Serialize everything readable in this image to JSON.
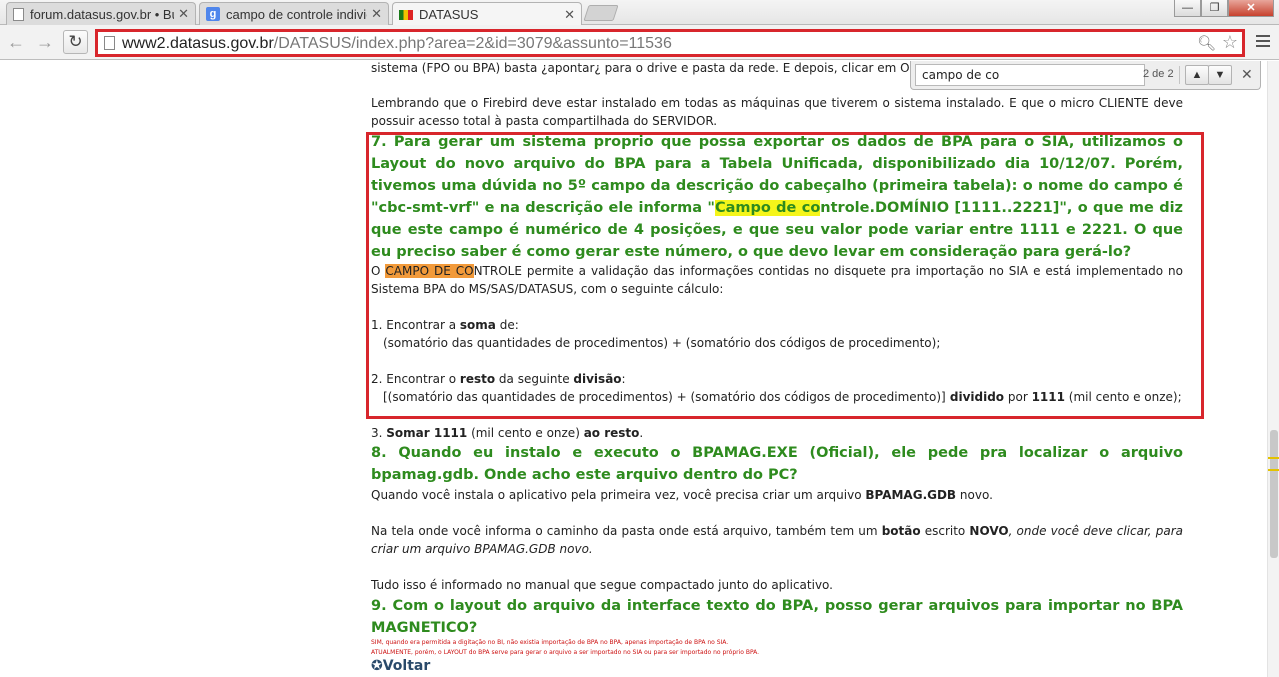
{
  "browser": {
    "tabs": [
      {
        "title": "forum.datasus.gov.br • Bu",
        "icon": "doc-icon"
      },
      {
        "title": "campo de controle indivic",
        "icon": "google-icon",
        "icon_glyph": "g"
      },
      {
        "title": "DATASUS",
        "icon": "flag-icon"
      }
    ],
    "tab_close_glyph": "✕",
    "window_controls": {
      "minimize": "—",
      "maximize": "❐",
      "close": "✕"
    },
    "nav": {
      "back": "←",
      "forward": "→",
      "reload": "↻"
    },
    "url": {
      "host": "www2.datasus.gov.br",
      "path": "/DATASUS/index.php?area=2&id=3079&assunto=11536"
    },
    "find": {
      "query": "campo de co",
      "count": "2 de 2",
      "prev": "▲",
      "next": "▼",
      "close": "✕"
    }
  },
  "article": {
    "p0": "sistema (FPO ou BPA) basta ¿apontar¿ para o drive e pasta da rede. E depois, clicar em OK.",
    "p1": "Lembrando que o Firebird deve estar instalado em todas as máquinas que tiverem o sistema instalado. E que o micro CLIENTE deve possuir acesso total à pasta compartilhada do SERVIDOR.",
    "q7_before": "7. Para gerar um sistema proprio que possa exportar os dados de BPA para o SIA, utilizamos o Layout do novo arquivo do BPA para a Tabela Unificada, disponibilizado dia 10/12/07. Porém, tivemos uma dúvida no 5º campo da descrição do cabeçalho (primeira tabela): o nome do campo é \"cbc-smt-vrf\" e na descrição ele informa \"",
    "q7_highlight": "Campo de co",
    "q7_after": "ntrole.DOMÍNIO [1111..2221]\", o que me diz que este campo é numérico de 4 posições, e que seu valor pode variar entre 1111 e 2221. O que eu preciso saber é como gerar este número, o que devo levar em consideração para gerá-lo?",
    "a7_prefix": "O ",
    "a7_highlight": "CAMPO DE CO",
    "a7_rest": "NTROLE permite a validação das informações contidas no disquete pra importação no SIA e está implementado no Sistema BPA do MS/SAS/DATASUS, com o seguinte cálculo:",
    "step1_a": "1. Encontrar a ",
    "step1_b": "soma",
    "step1_c": " de:",
    "step1_detail": "(somatório das quantidades de procedimentos) + (somatório dos códigos de procedimento);",
    "step2_a": "2. Encontrar o ",
    "step2_b": "resto",
    "step2_c": " da seguinte ",
    "step2_d": "divisão",
    "step2_e": ":",
    "step2_detail_a": "[(somatório das quantidades de procedimentos) + (somatório dos códigos de procedimento)]",
    "step2_detail_b": " dividido",
    "step2_detail_c": " por ",
    "step2_detail_d": "1111",
    "step2_detail_e": " (mil cento e onze);",
    "step3_a": "3. ",
    "step3_b": "Somar 1111",
    "step3_c": " (mil cento e onze) ",
    "step3_d": "ao resto",
    "step3_e": ".",
    "q8": "8. Quando eu instalo e executo o BPAMAG.EXE (Oficial), ele pede pra localizar o arquivo bpamag.gdb. Onde acho este arquivo dentro do PC?",
    "a8_1a": "Quando você instala o aplicativo pela primeira vez, você precisa criar um arquivo ",
    "a8_1b": "BPAMAG.GDB",
    "a8_1c": " novo.",
    "a8_2a": "Na tela onde você informa o caminho da pasta onde está arquivo, também tem um ",
    "a8_2b": "botão",
    "a8_2c": " escrito ",
    "a8_2d": "NOVO",
    "a8_2e": ", onde você deve clicar, para criar um arquivo BPAMAG.GDB novo.",
    "a8_3": "Tudo isso é informado no manual que segue compactado junto do aplicativo.",
    "q9": "9. Com o layout do arquivo da interface texto do BPA, posso gerar arquivos para importar no BPA MAGNETICO?",
    "a9_1": "SIM, quando era permitida a digitação no BI, não existia importação de BPA no BPA, apenas importação de BPA no SIA.",
    "a9_2": "ATUALMENTE, porém, o LAYOUT do BPA serve para gerar o arquivo a ser importado no SIA ou para ser importado no próprio BPA.",
    "voltar": "Voltar",
    "voltar_icon": "✪"
  },
  "colors": {
    "annotation_red": "#d8262c",
    "question_green": "#2e8b1e",
    "find_highlight_yellow": "#f5f51a",
    "find_highlight_orange": "#f29a3a"
  }
}
